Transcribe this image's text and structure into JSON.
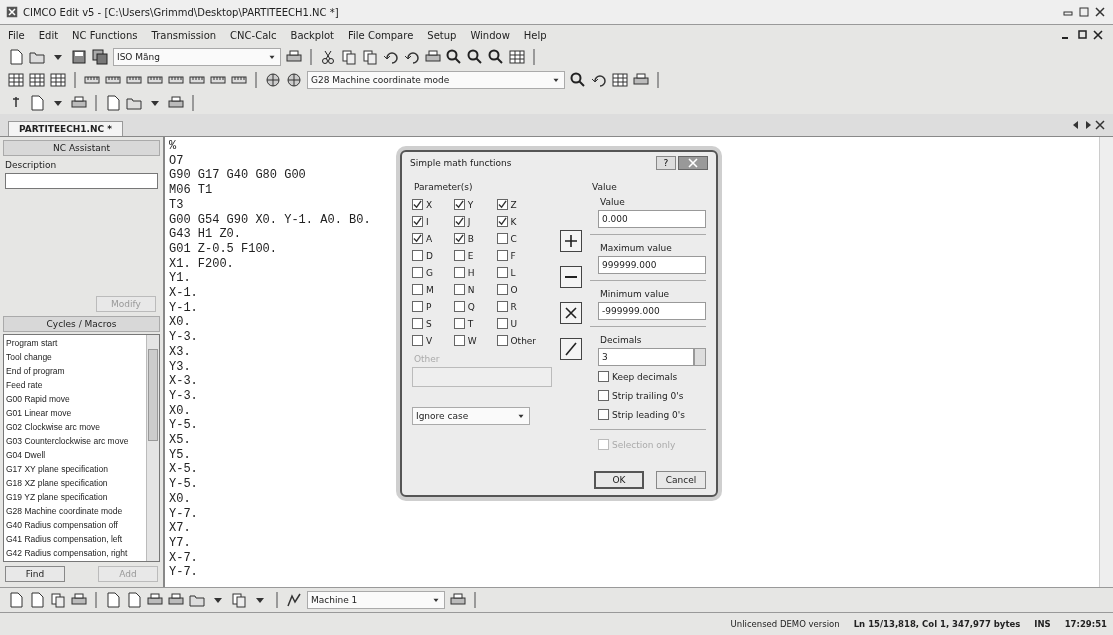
{
  "window": {
    "title": "CIMCO Edit v5 - [C:\\Users\\Grimmd\\Desktop\\PARTITEECH1.NC *]"
  },
  "menu": [
    "File",
    "Edit",
    "NC Functions",
    "Transmission",
    "CNC-Calc",
    "Backplot",
    "File Compare",
    "Setup",
    "Window",
    "Help"
  ],
  "toolbar": {
    "encoding_dropdown": "ISO Mãng",
    "mode_dropdown": "G28 Machine coordinate mode"
  },
  "document_tab": {
    "label": "PARTITEECH1.NC *",
    "selected": true
  },
  "nc_assistant": {
    "title": "NC Assistant",
    "description_label": "Description",
    "modify_button": {
      "label": "Modify",
      "disabled": true
    }
  },
  "cycles_macros": {
    "title": "Cycles / Macros",
    "items": [
      "Program start",
      "Tool change",
      "End of program",
      "Feed rate",
      "G00 Rapid move",
      "G01 Linear move",
      "G02 Clockwise arc move",
      "G03 Counterclockwise arc move",
      "G04 Dwell",
      "G17 XY plane specification",
      "G18 XZ plane specification",
      "G19 YZ plane specification",
      "G28 Machine coordinate mode",
      "G40 Radius compensation off",
      "G41 Radius compensation, left",
      "G42 Radius compensation, right"
    ],
    "find_button": {
      "label": "Find",
      "disabled": false
    },
    "add_button": {
      "label": "Add",
      "disabled": true
    }
  },
  "editor": {
    "lines": [
      "%",
      "O7",
      "G90 G17 G40 G80 G00",
      "M06 T1",
      "T3",
      "G00 G54 G90 X0. Y-1. A0. B0.",
      "G43 H1 Z0.",
      "G01 Z-0.5 F100.",
      "X1. F200.",
      "Y1.",
      "X-1.",
      "Y-1.",
      "X0.",
      "Y-3.",
      "X3.",
      "Y3.",
      "X-3.",
      "Y-3.",
      "X0.",
      "Y-5.",
      "X5.",
      "Y5.",
      "X-5.",
      "Y-5.",
      "X0.",
      "Y-7.",
      "X7.",
      "Y7.",
      "X-7.",
      "Y-7."
    ]
  },
  "dialog": {
    "title": "Simple math functions",
    "help": "?",
    "parameters_label": "Parameter(s)",
    "parameters": [
      {
        "label": "X",
        "checked": true
      },
      {
        "label": "Y",
        "checked": true
      },
      {
        "label": "Z",
        "checked": true
      },
      {
        "label": "I",
        "checked": true
      },
      {
        "label": "J",
        "checked": true
      },
      {
        "label": "K",
        "checked": true
      },
      {
        "label": "A",
        "checked": true
      },
      {
        "label": "B",
        "checked": true
      },
      {
        "label": "C",
        "checked": false
      },
      {
        "label": "D",
        "checked": false
      },
      {
        "label": "E",
        "checked": false
      },
      {
        "label": "F",
        "checked": false
      },
      {
        "label": "G",
        "checked": false
      },
      {
        "label": "H",
        "checked": false
      },
      {
        "label": "L",
        "checked": false
      },
      {
        "label": "M",
        "checked": false
      },
      {
        "label": "N",
        "checked": false
      },
      {
        "label": "O",
        "checked": false
      },
      {
        "label": "P",
        "checked": false
      },
      {
        "label": "Q",
        "checked": false
      },
      {
        "label": "R",
        "checked": false
      },
      {
        "label": "S",
        "checked": false
      },
      {
        "label": "T",
        "checked": false
      },
      {
        "label": "U",
        "checked": false
      },
      {
        "label": "V",
        "checked": false
      },
      {
        "label": "W",
        "checked": false
      },
      {
        "label": "Other",
        "checked": false
      }
    ],
    "other_field": {
      "label": "Other",
      "disabled": true
    },
    "case_dropdown": "Ignore case",
    "value_group": "Value",
    "fields": [
      {
        "label": "Value",
        "value": "0.000"
      },
      {
        "label": "Maximum value",
        "value": "999999.000"
      },
      {
        "label": "Minimum value",
        "value": "-999999.000"
      }
    ],
    "decimals": {
      "label": "Decimals",
      "value": "3"
    },
    "options": [
      {
        "label": "Keep decimals",
        "checked": false,
        "disabled": false
      },
      {
        "label": "Strip trailing 0's",
        "checked": false,
        "disabled": false
      },
      {
        "label": "Strip leading 0's",
        "checked": false,
        "disabled": false
      },
      {
        "label": "Selection only",
        "checked": false,
        "disabled": true
      }
    ],
    "buttons": [
      "OK",
      "Cancel"
    ]
  },
  "bottom_toolbar": {
    "machine_dropdown": "Machine 1"
  },
  "status_bar": {
    "license": "Unlicensed DEMO version",
    "position": "Ln 15/13,818, Col 1, 347,977 bytes",
    "mode": "INS",
    "time": "17:29:51"
  }
}
